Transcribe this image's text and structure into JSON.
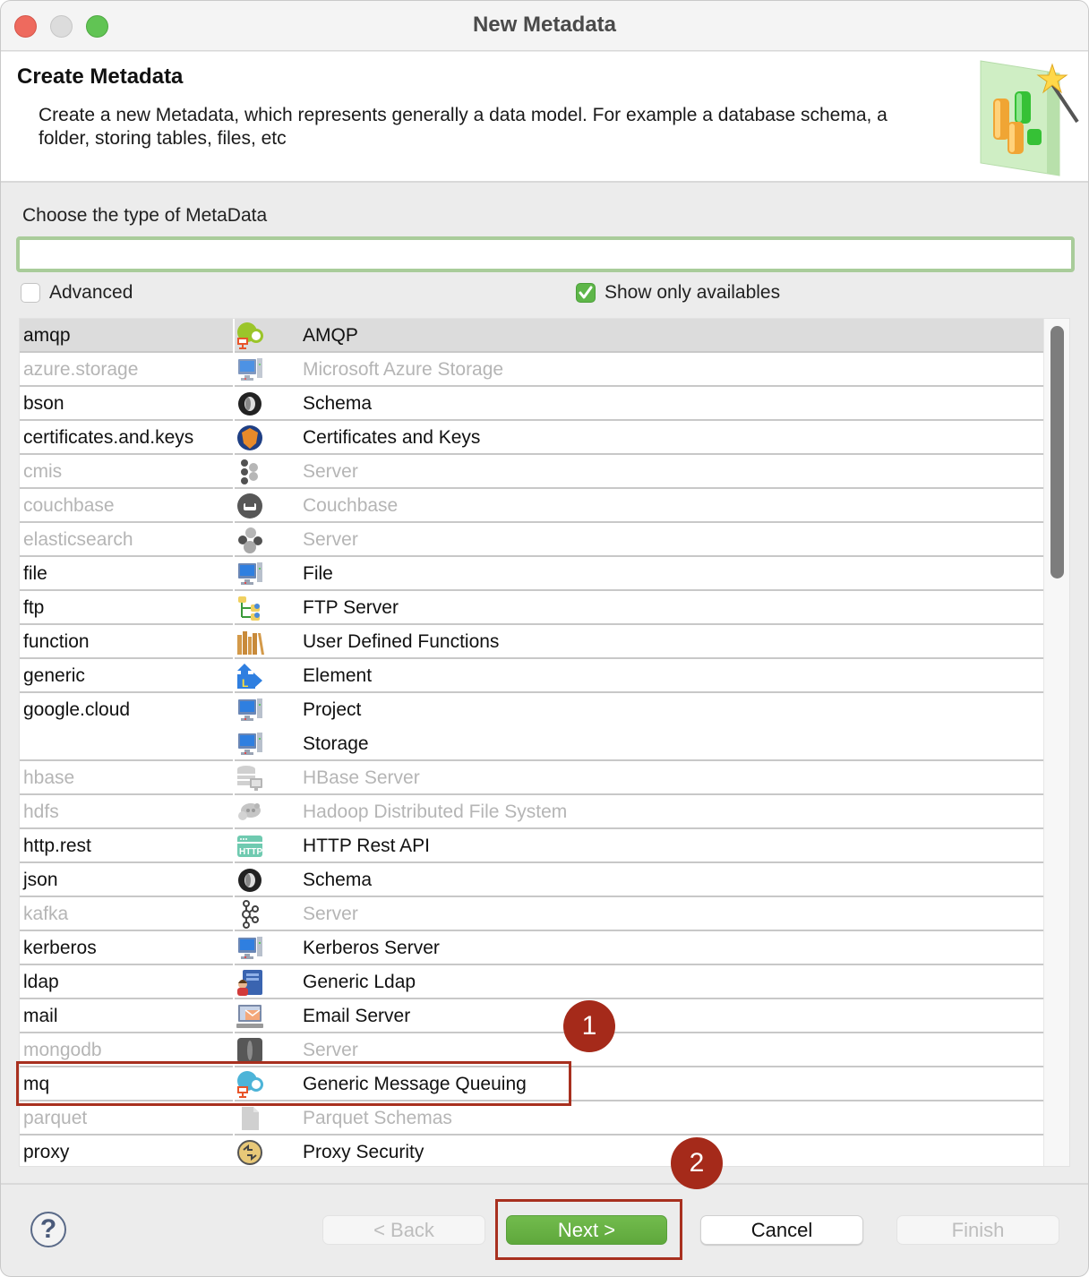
{
  "window": {
    "title": "New Metadata",
    "traffic_lights": [
      "close",
      "minimize",
      "zoom"
    ]
  },
  "banner": {
    "title": "Create Metadata",
    "description": "Create a new Metadata, which represents generally a data model. For example a database schema, a folder, storing tables, files, etc",
    "icon": "metadata-wizard-icon"
  },
  "filter": {
    "label": "Choose the type of MetaData",
    "value": "",
    "placeholder": ""
  },
  "options": {
    "advanced": {
      "label": "Advanced",
      "checked": false
    },
    "show_only_availables": {
      "label": "Show only availables",
      "checked": true
    }
  },
  "list": {
    "selected_index": 0,
    "scroll_position": 0.0,
    "rows": [
      {
        "key": "amqp",
        "label": "AMQP",
        "icon": "amqp-icon",
        "enabled": true
      },
      {
        "key": "azure.storage",
        "label": "Microsoft Azure Storage",
        "icon": "computer-icon",
        "enabled": false
      },
      {
        "key": "bson",
        "label": "Schema",
        "icon": "schema-ring-icon",
        "enabled": true
      },
      {
        "key": "certificates.and.keys",
        "label": "Certificates and Keys",
        "icon": "shield-icon",
        "enabled": true
      },
      {
        "key": "cmis",
        "label": "Server",
        "icon": "cmis-icon",
        "enabled": false
      },
      {
        "key": "couchbase",
        "label": "Couchbase",
        "icon": "couchbase-icon",
        "enabled": false
      },
      {
        "key": "elasticsearch",
        "label": "Server",
        "icon": "elasticsearch-icon",
        "enabled": false
      },
      {
        "key": "file",
        "label": "File",
        "icon": "computer-icon",
        "enabled": true
      },
      {
        "key": "ftp",
        "label": "FTP Server",
        "icon": "ftp-tree-icon",
        "enabled": true
      },
      {
        "key": "function",
        "label": "User Defined Functions",
        "icon": "books-icon",
        "enabled": true
      },
      {
        "key": "generic",
        "label": "Element",
        "icon": "generic-element-icon",
        "enabled": true
      },
      {
        "key": "google.cloud",
        "label": "Project",
        "icon": "computer-icon",
        "enabled": true
      },
      {
        "key": "",
        "label": "Storage",
        "icon": "computer-icon",
        "enabled": true
      },
      {
        "key": "hbase",
        "label": "HBase Server",
        "icon": "database-server-icon",
        "enabled": false
      },
      {
        "key": "hdfs",
        "label": "Hadoop Distributed File System",
        "icon": "hadoop-icon",
        "enabled": false
      },
      {
        "key": "http.rest",
        "label": "HTTP Rest API",
        "icon": "http-icon",
        "enabled": true
      },
      {
        "key": "json",
        "label": "Schema",
        "icon": "schema-ring-icon",
        "enabled": true
      },
      {
        "key": "kafka",
        "label": "Server",
        "icon": "kafka-icon",
        "enabled": false
      },
      {
        "key": "kerberos",
        "label": "Kerberos Server",
        "icon": "computer-icon",
        "enabled": true
      },
      {
        "key": "ldap",
        "label": "Generic Ldap",
        "icon": "ldap-icon",
        "enabled": true
      },
      {
        "key": "mail",
        "label": "Email Server",
        "icon": "email-server-icon",
        "enabled": true
      },
      {
        "key": "mongodb",
        "label": "Server",
        "icon": "mongodb-leaf-icon",
        "enabled": false
      },
      {
        "key": "mq",
        "label": "Generic Message Queuing",
        "icon": "mq-icon",
        "enabled": true
      },
      {
        "key": "parquet",
        "label": "Parquet Schemas",
        "icon": "document-icon",
        "enabled": false
      },
      {
        "key": "proxy",
        "label": "Proxy Security",
        "icon": "proxy-icon",
        "enabled": true
      }
    ]
  },
  "footer": {
    "help_icon": "help-icon",
    "back_label": "< Back",
    "back_enabled": false,
    "next_label": "Next >",
    "next_enabled": true,
    "cancel_label": "Cancel",
    "cancel_enabled": true,
    "finish_label": "Finish",
    "finish_enabled": false
  },
  "annotations": {
    "step1": {
      "label": "1",
      "target": "mq"
    },
    "step2": {
      "label": "2",
      "target": "next-button"
    },
    "color": "#a52a1a"
  },
  "colors": {
    "accent_green": "#5fa83c",
    "filter_border": "#a9cc9a",
    "disabled_text": "#b5b5b5",
    "selected_row": "#dcdcdc"
  }
}
